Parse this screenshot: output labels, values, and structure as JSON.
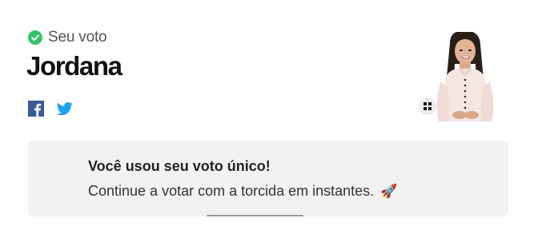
{
  "vote": {
    "status_label": "Seu voto",
    "status_icon": "check-circle-icon",
    "status_color": "#37c26e",
    "candidate_name": "Jordana"
  },
  "share": {
    "facebook_icon": "facebook-icon",
    "facebook_color": "#3b5998",
    "twitter_icon": "twitter-icon",
    "twitter_color": "#1da1f2"
  },
  "avatar": {
    "icon": "candidate-photo",
    "expand_icon": "expand-icon"
  },
  "notice": {
    "title": "Você usou seu voto único!",
    "body": "Continue a votar com a torcida em instantes.",
    "emoji": "🚀",
    "background": "#f2f2f2"
  }
}
